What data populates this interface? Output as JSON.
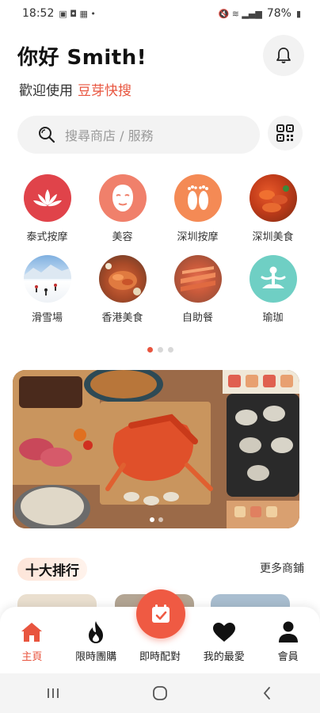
{
  "status_bar": {
    "time": "18:52",
    "battery": "78%"
  },
  "header": {
    "greeting": "你好 Smith!",
    "welcome_prefix": "歡迎使用",
    "brand": "豆芽快搜"
  },
  "search": {
    "placeholder": "搜尋商店 / 服務"
  },
  "categories": [
    {
      "label": "泰式按摩",
      "icon": "lotus-icon"
    },
    {
      "label": "美容",
      "icon": "face-mask-icon"
    },
    {
      "label": "深圳按摩",
      "icon": "feet-icon"
    },
    {
      "label": "深圳美食",
      "icon": "crayfish-photo"
    },
    {
      "label": "滑雪場",
      "icon": "ski-photo"
    },
    {
      "label": "香港美食",
      "icon": "hk-food-photo"
    },
    {
      "label": "自助餐",
      "icon": "buffet-photo"
    },
    {
      "label": "瑜珈",
      "icon": "yoga-icon"
    }
  ],
  "ranking": {
    "title": "十大排行",
    "more": "更多商鋪"
  },
  "bottom_nav": {
    "home": "主頁",
    "deals": "限時團購",
    "booking": "即時配對",
    "favorites": "我的最愛",
    "member": "會員"
  },
  "colors": {
    "accent": "#e8553f",
    "fab": "#ef5a43"
  }
}
